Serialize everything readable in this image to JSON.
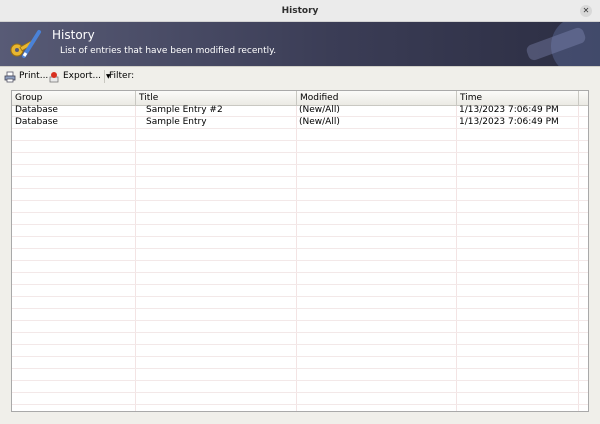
{
  "window": {
    "title": "History",
    "close_glyph": "✕"
  },
  "banner": {
    "title": "History",
    "subtitle": "List of entries that have been modified recently.",
    "icon": "keys-pen-icon"
  },
  "toolbar": {
    "print_label": "Print...",
    "export_label": "Export...",
    "filter_label": "Filter:",
    "filter_value": ""
  },
  "table": {
    "columns": [
      "Group",
      "Title",
      "Modified",
      "Time"
    ],
    "rows": [
      [
        "Database",
        "Sample Entry #2",
        "(New/All)",
        "1/13/2023 7:06:49 PM"
      ],
      [
        "Database",
        "Sample Entry",
        "(New/All)",
        "1/13/2023 7:06:49 PM"
      ]
    ]
  },
  "colors": {
    "banner": "#3b3d56",
    "grid": "#f3e4e4"
  }
}
